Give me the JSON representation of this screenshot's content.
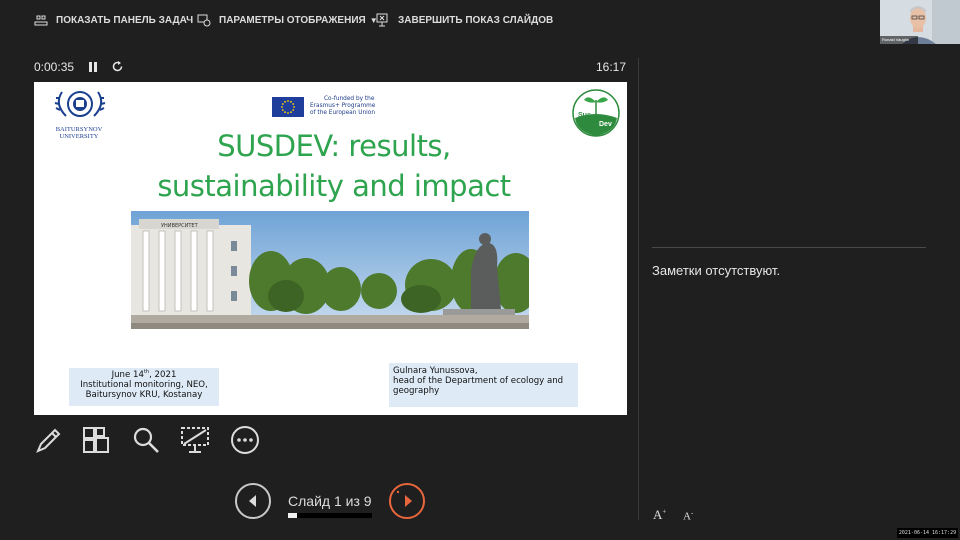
{
  "toolbar": {
    "show_taskbar": "ПОКАЗАТЬ ПАНЕЛЬ ЗАДАЧ",
    "display_settings": "ПАРАМЕТРЫ ОТОБРАЖЕНИЯ",
    "end_show": "ЗАВЕРШИТЬ ПОКАЗ СЛАЙДОВ"
  },
  "webcam": {
    "name": "Ronald Vaughn"
  },
  "timer": {
    "elapsed": "0:00:35",
    "clock": "16:17"
  },
  "slide": {
    "university_name_line1": "BAITURSYNOV",
    "university_name_line2": "UNIVERSITY",
    "eu_line1": "Co-funded by the",
    "eu_line2": "Erasmus+ Programme",
    "eu_line3": "of the European Union",
    "sus_logo_left": "Sus",
    "sus_logo_right": "Dev",
    "title_line1": "SUSDEV: results,",
    "title_line2": "sustainability and impact",
    "building_sign": "УНИВЕРСИТЕТ",
    "left_box": {
      "date_day": "June 14",
      "date_sup": "th",
      "date_year": ", 2021",
      "line2": "Institutional monitoring, NEO,",
      "line3": "Baitursynov KRU, Kostanay"
    },
    "right_box": {
      "line1": "Gulnara Yunussova,",
      "line2": "head of the Department of ecology and",
      "line3": "geography"
    }
  },
  "navigation": {
    "counter": "Слайд 1 из 9",
    "current": 1,
    "total": 9,
    "progress_fraction": 0.111
  },
  "notes": {
    "text": "Заметки отсутствуют."
  },
  "font_controls": {
    "increase": "A",
    "decrease": "A"
  },
  "timestamp": "2021-06-14 16:17:29",
  "colors": {
    "background": "#1f1f1f",
    "title_green": "#2ea44f",
    "next_accent": "#e8663c",
    "box_blue": "#deebf7"
  },
  "icons": {
    "taskbar": "taskbar-icon",
    "display": "display-settings-icon",
    "end": "end-show-icon",
    "pause": "pause-icon",
    "restart": "restart-icon",
    "pen": "pen-icon",
    "grid": "slide-grid-icon",
    "zoom": "magnifier-icon",
    "screen": "black-screen-icon",
    "more": "more-options-icon",
    "prev": "previous-arrow-icon",
    "next": "next-arrow-icon"
  }
}
